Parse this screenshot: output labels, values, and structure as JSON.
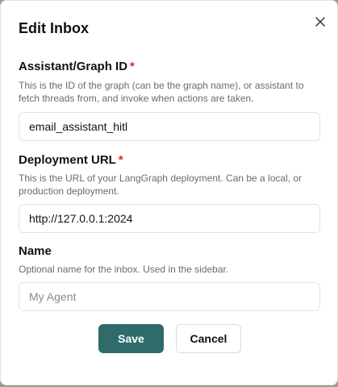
{
  "dialog": {
    "title": "Edit Inbox",
    "close_icon": "close-icon"
  },
  "fields": {
    "assistant": {
      "label": "Assistant/Graph ID",
      "required_mark": "*",
      "help": "This is the ID of the graph (can be the graph name), or assistant to fetch threads from, and invoke when actions are taken.",
      "value": "email_assistant_hitl"
    },
    "deployment": {
      "label": "Deployment URL",
      "required_mark": "*",
      "help": "This is the URL of your LangGraph deployment. Can be a local, or production deployment.",
      "value": "http://127.0.0.1:2024"
    },
    "name": {
      "label": "Name",
      "help": "Optional name for the inbox. Used in the sidebar.",
      "placeholder": "My Agent",
      "value": ""
    }
  },
  "actions": {
    "save_label": "Save",
    "cancel_label": "Cancel"
  },
  "colors": {
    "primary": "#2f6b6b",
    "required": "#e02424"
  }
}
